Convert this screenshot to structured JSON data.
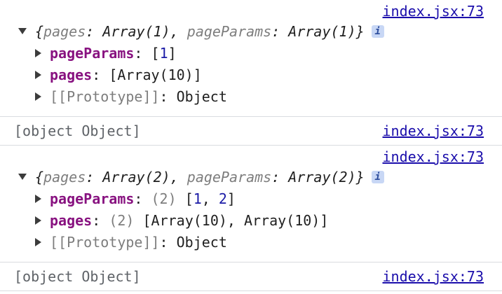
{
  "entries": [
    {
      "source": "index.jsx:73",
      "summary": {
        "open": "{",
        "pages_key": "pages",
        "pages_val": "Array(1)",
        "params_key": "pageParams",
        "params_val": "Array(1)",
        "close": "}"
      },
      "info_label": "i",
      "children": [
        {
          "key": "pageParams",
          "count": "",
          "value_parts": [
            "[",
            "1",
            "]"
          ]
        },
        {
          "key": "pages",
          "count": "",
          "value": "[Array(10)]"
        },
        {
          "key": "[[Prototype]]",
          "value": "Object"
        }
      ]
    },
    {
      "source": "index.jsx:73",
      "text": "[object Object]"
    },
    {
      "source": "index.jsx:73",
      "summary": {
        "open": "{",
        "pages_key": "pages",
        "pages_val": "Array(2)",
        "params_key": "pageParams",
        "params_val": "Array(2)",
        "close": "}"
      },
      "info_label": "i",
      "children": [
        {
          "key": "pageParams",
          "count": "(2)",
          "value_parts": [
            "[",
            "1",
            ", ",
            "2",
            "]"
          ]
        },
        {
          "key": "pages",
          "count": "(2)",
          "value": "[Array(10), Array(10)]"
        },
        {
          "key": "[[Prototype]]",
          "value": "Object"
        }
      ]
    },
    {
      "source": "index.jsx:73",
      "text": "[object Object]"
    }
  ]
}
